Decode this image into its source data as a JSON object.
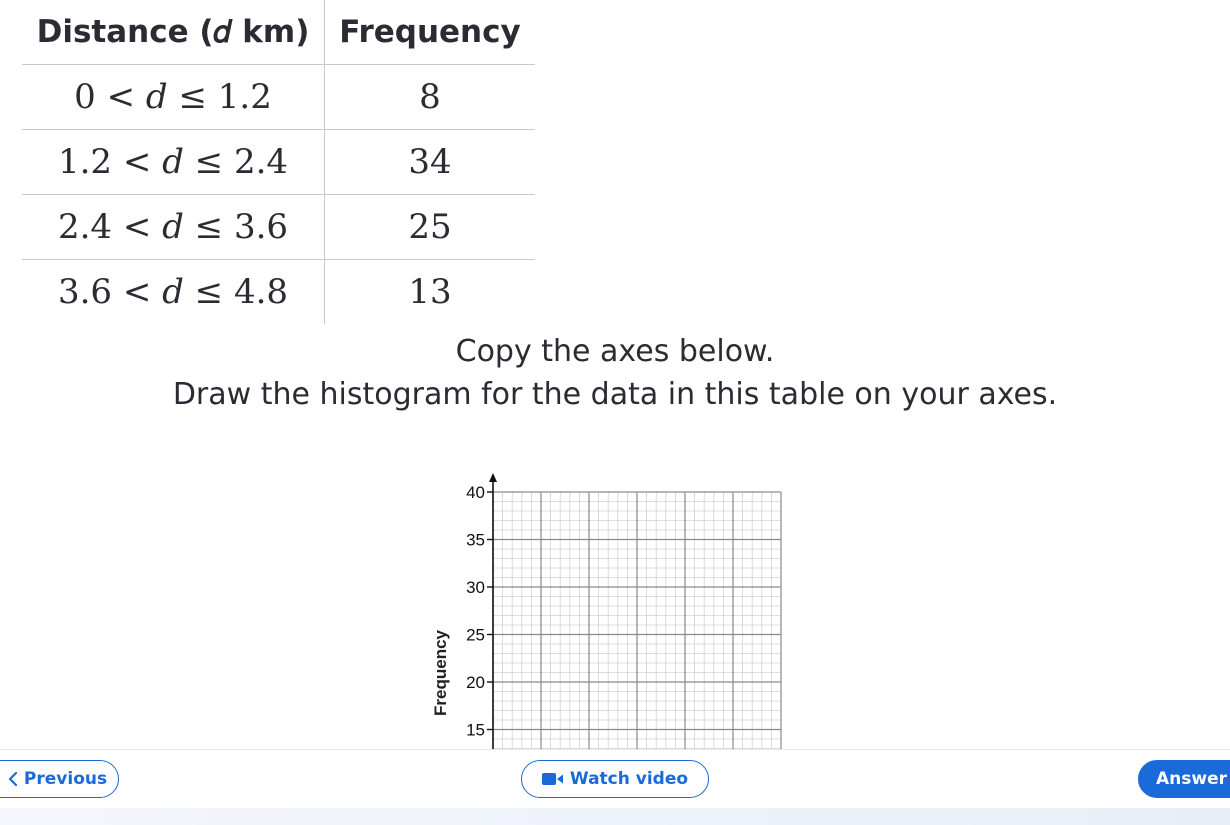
{
  "table": {
    "headers": {
      "interval": "Distance (𝑑 km)",
      "frequency": "Frequency"
    },
    "rows": [
      {
        "interval": "0 < 𝑑 ≤ 1.2",
        "frequency": "8"
      },
      {
        "interval": "1.2 < 𝑑 ≤ 2.4",
        "frequency": "34"
      },
      {
        "interval": "2.4 < 𝑑 ≤ 3.6",
        "frequency": "25"
      },
      {
        "interval": "3.6 < 𝑑 ≤ 4.8",
        "frequency": "13"
      }
    ]
  },
  "instructions": {
    "line1": "Copy the axes below.",
    "line2": "Draw the histogram for the data in this table on your axes."
  },
  "chart_data": {
    "type": "histogram-axes",
    "ylabel": "Frequency",
    "ytick_labels": [
      "15",
      "20",
      "25",
      "30",
      "35",
      "40"
    ],
    "yticks": [
      15,
      20,
      25,
      30,
      35,
      40
    ],
    "ylim": [
      13,
      40
    ],
    "x_major_columns": 6,
    "grid": true
  },
  "nav": {
    "previous_label": "Previous",
    "video_label": "Watch video",
    "answer_label": "Answer"
  },
  "colors": {
    "accent": "#1a6ad9",
    "text": "#2b2b33",
    "grid_major": "#8a8a8a",
    "grid_minor": "#d2d2d2"
  },
  "icons": {
    "previous": "chevron-left-icon",
    "video": "video-camera-icon"
  }
}
